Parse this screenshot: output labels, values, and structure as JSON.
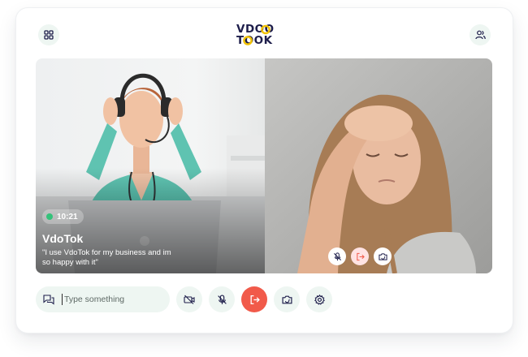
{
  "app": {
    "logo_line1": "VDOO",
    "logo_line2": "TOOK",
    "accent": "#f15a4a",
    "brand_navy": "#1d1d4a",
    "brand_yellow": "#f2c200",
    "soft_green": "#eef6f2"
  },
  "header": {
    "left_icon": "grid-icon",
    "right_icon": "users-icon"
  },
  "call": {
    "timer": "10:21",
    "caller_name": "VdoTok",
    "quote": "\"I use VdoTok for my business and im so happy with it\"",
    "status_dot_color": "#34c27a"
  },
  "remote_controls": [
    {
      "icon": "mic-off-icon"
    },
    {
      "icon": "leave-call-icon"
    },
    {
      "icon": "camera-switch-icon"
    }
  ],
  "toolbar": {
    "chat_placeholder": "Type something",
    "controls": [
      {
        "icon": "video-off-icon"
      },
      {
        "icon": "mic-off-icon"
      },
      {
        "icon": "end-call-icon"
      },
      {
        "icon": "camera-switch-icon"
      },
      {
        "icon": "settings-icon"
      }
    ]
  }
}
